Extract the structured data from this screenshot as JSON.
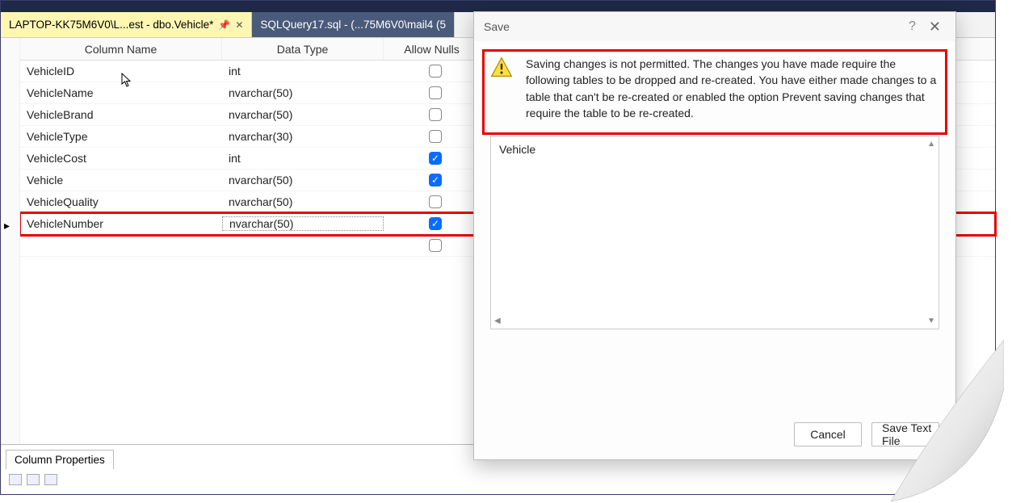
{
  "tabs": {
    "active": {
      "label": "LAPTOP-KK75M6V0\\L...est - dbo.Vehicle*"
    },
    "inactive": {
      "label": "SQLQuery17.sql - (...75M6V0\\mail4 (5"
    }
  },
  "grid": {
    "headers": {
      "name": "Column Name",
      "type": "Data Type",
      "nulls": "Allow Nulls"
    },
    "rows": [
      {
        "name": "VehicleID",
        "type": "int",
        "nulls": false,
        "selected": false
      },
      {
        "name": "VehicleName",
        "type": "nvarchar(50)",
        "nulls": false,
        "selected": false
      },
      {
        "name": "VehicleBrand",
        "type": "nvarchar(50)",
        "nulls": false,
        "selected": false
      },
      {
        "name": "VehicleType",
        "type": "nvarchar(30)",
        "nulls": false,
        "selected": false
      },
      {
        "name": "VehicleCost",
        "type": "int",
        "nulls": true,
        "selected": false
      },
      {
        "name": "Vehicle",
        "type": "nvarchar(50)",
        "nulls": true,
        "selected": false
      },
      {
        "name": "VehicleQuality",
        "type": "nvarchar(50)",
        "nulls": false,
        "selected": false
      },
      {
        "name": "VehicleNumber",
        "type": "nvarchar(50)",
        "nulls": true,
        "selected": true
      }
    ]
  },
  "properties": {
    "tab_label": "Column Properties"
  },
  "dialog": {
    "title": "Save",
    "help": "?",
    "close": "✕",
    "message": "Saving changes is not permitted. The changes you have made require the following tables to be dropped and re-created. You have either made changes to a table that can't be re-created or enabled the option Prevent saving changes that require the table to be re-created.",
    "list_item": "Vehicle",
    "buttons": {
      "cancel": "Cancel",
      "save": "Save Text File"
    }
  }
}
